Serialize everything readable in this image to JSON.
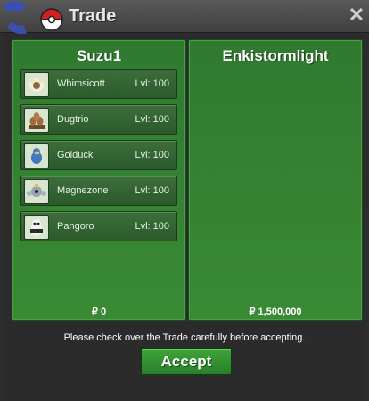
{
  "window": {
    "title": "Trade",
    "close_icon": "close-icon"
  },
  "left_panel": {
    "player": "Suzu1",
    "money": "₽ 0",
    "pokemon": [
      {
        "name": "Whimsicott",
        "level": "Lvl: 100"
      },
      {
        "name": "Dugtrio",
        "level": "Lvl: 100"
      },
      {
        "name": "Golduck",
        "level": "Lvl: 100"
      },
      {
        "name": "Magnezone",
        "level": "Lvl: 100"
      },
      {
        "name": "Pangoro",
        "level": "Lvl: 100"
      }
    ]
  },
  "right_panel": {
    "player": "Enkistormlight",
    "money": "₽ 1,500,000"
  },
  "notice": "Please check over the Trade carefully before accepting.",
  "accept_label": "Accept"
}
